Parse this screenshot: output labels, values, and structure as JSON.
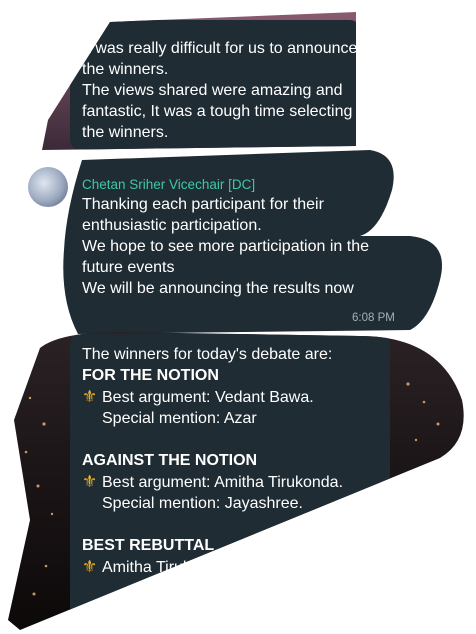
{
  "messages": [
    {
      "id": "msg1",
      "lines": [
        "It was really difficult for us to announce",
        "the winners.",
        "The views shared were amazing and",
        "fantastic, It was a tough time selecting",
        "the winners."
      ]
    },
    {
      "id": "msg2",
      "sender": "Chetan Sriher Vicechair [DC]",
      "lines": [
        "Thanking each participant for their",
        "enthusiastic participation.",
        "We hope to see more participation in the",
        "future  events",
        "We will be announcing the results now"
      ],
      "time": "6:08 PM"
    },
    {
      "id": "msg3",
      "intro": "The winners for today's debate are:",
      "sections": [
        {
          "heading": "FOR THE NOTION",
          "best": "Best argument: Vedant Bawa.",
          "special": "Special mention: Azar"
        },
        {
          "heading": "AGAINST THE NOTION",
          "best": "Best argument: Amitha Tirukonda.",
          "special": "Special mention: Jayashree."
        },
        {
          "heading": "BEST REBUTTAL",
          "best": "Amitha Tirukonda"
        }
      ]
    }
  ],
  "icons": {
    "bullet": "fleur-de-lis-icon",
    "avatar": "user-avatar-icon"
  },
  "colors": {
    "bubble": "#1f2c33",
    "sender": "#3fc7a6",
    "bullet": "#f3b320",
    "timestamp": "#9fb2b4",
    "background": "#ffffff"
  }
}
